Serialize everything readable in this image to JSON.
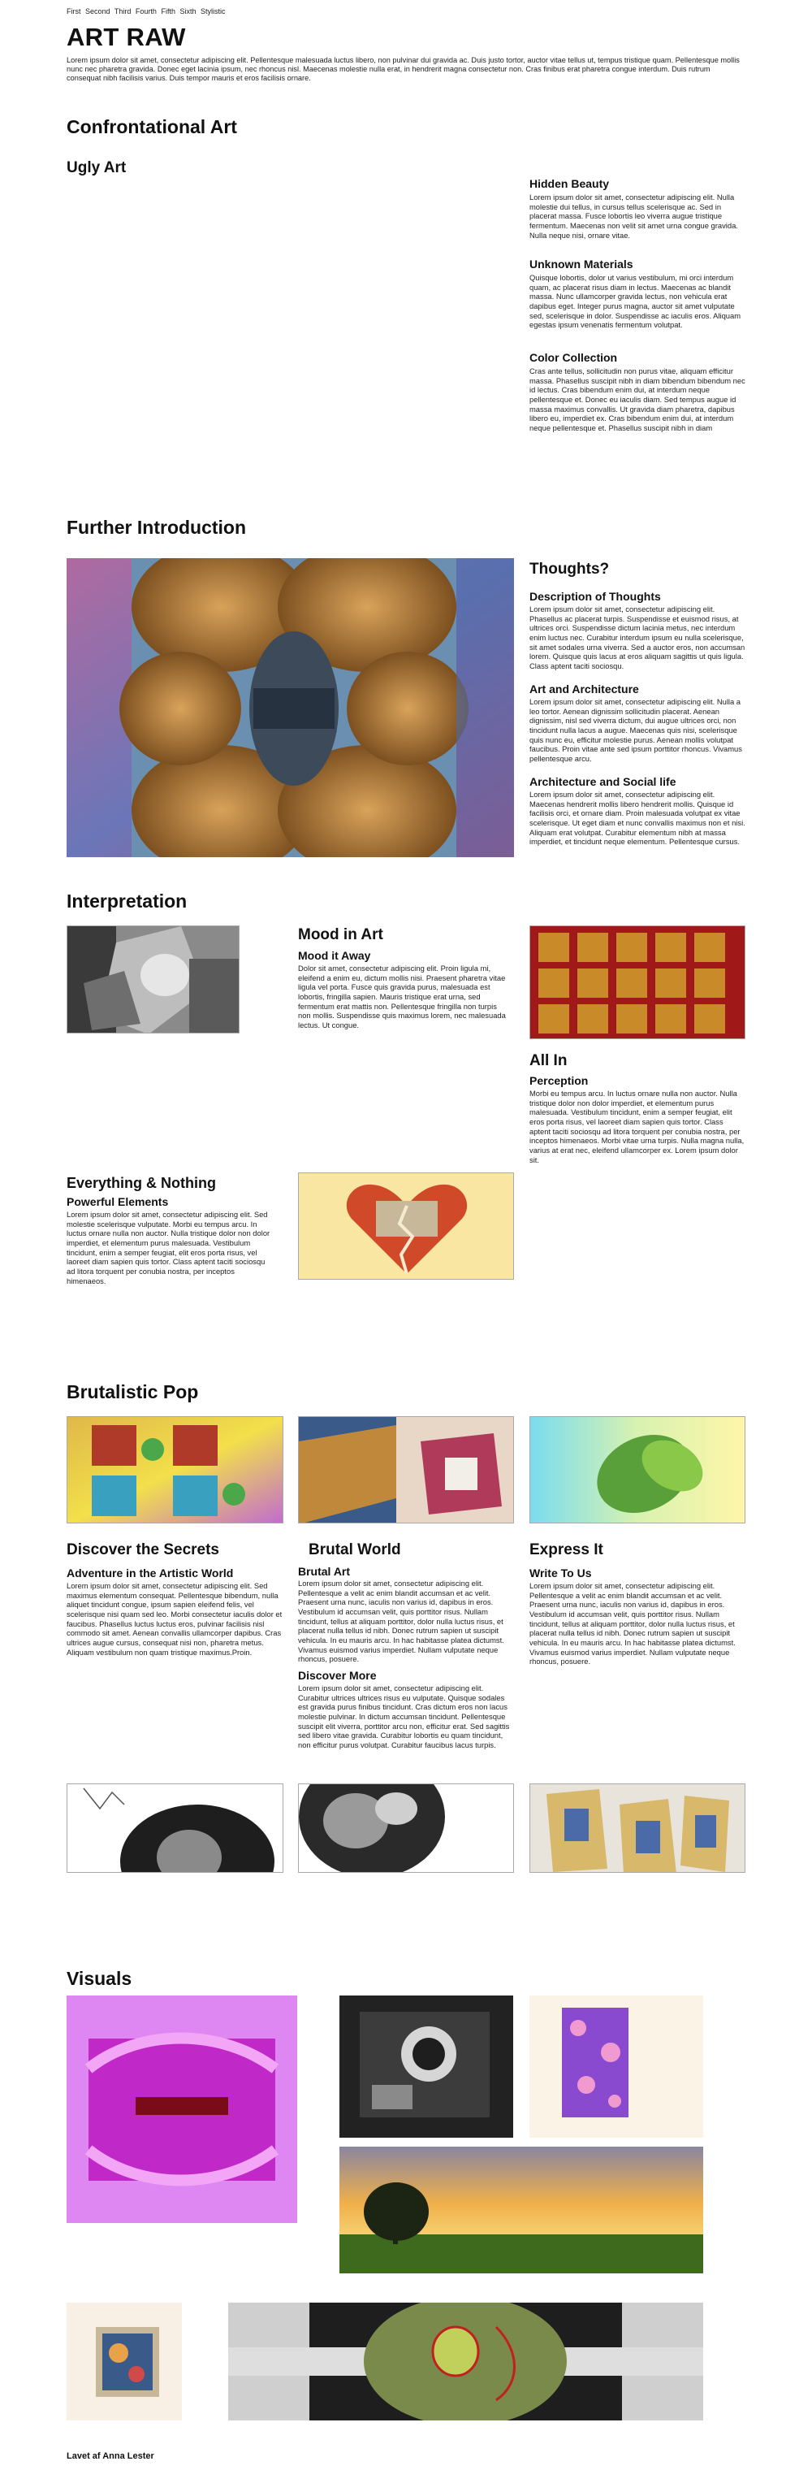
{
  "nav": [
    "First",
    "Second",
    "Third",
    "Fourth",
    "Fifth",
    "Sixth",
    "Stylistic"
  ],
  "site_title": "ART RAW",
  "intro": "Lorem ipsum dolor sit amet, consectetur adipiscing elit. Pellentesque malesuada luctus libero, non pulvinar dui gravida ac. Duis justo tortor, auctor vitae tellus ut, tempus tristique quam. Pellentesque mollis nunc nec pharetra gravida. Donec eget lacinia ipsum, nec rhoncus nisl. Maecenas molestie nulla erat, in hendrerit magna consectetur non. Cras finibus erat pharetra congue interdum. Duis rutrum consequat nibh facilisis varius. Duis tempor mauris et eros facilisis ornare.",
  "s1": {
    "title": "Confrontational Art",
    "subtitle": "Ugly Art",
    "cols": [
      {
        "h": "Hidden Beauty",
        "p": "Lorem ipsum dolor sit amet, consectetur adipiscing elit. Nulla molestie dui tellus, in cursus tellus scelerisque ac. Sed in placerat massa. Fusce lobortis leo viverra augue tristique fermentum. Maecenas non velit sit amet urna congue gravida. Nulla neque nisi, ornare vitae."
      },
      {
        "h": "Unknown Materials",
        "p": "Quisque lobortis, dolor ut varius vestibulum, mi orci interdum quam, ac placerat risus diam in lectus. Maecenas ac blandit massa. Nunc ullamcorper gravida lectus, non vehicula erat dapibus eget. Integer purus magna, auctor sit amet vulputate sed, scelerisque in dolor. Suspendisse ac iaculis eros. Aliquam egestas ipsum venenatis fermentum volutpat."
      },
      {
        "h": "Color Collection",
        "p": "Cras ante tellus, sollicitudin non purus vitae, aliquam efficitur massa. Phasellus suscipit nibh in diam bibendum bibendum nec id lectus. Cras bibendum enim dui, at interdum neque pellentesque et. Donec eu iaculis diam. Sed tempus augue id massa maximus convallis. Ut gravida diam pharetra, dapibus libero eu, imperdiet ex. Cras bibendum enim dui, at interdum neque pellentesque et. Phasellus suscipit nibh in diam"
      }
    ]
  },
  "s2": {
    "title": "Further Introduction",
    "aside_title": "Thoughts?",
    "cols": [
      {
        "h": "Description of Thoughts",
        "p": "Lorem ipsum dolor sit amet, consectetur adipiscing elit. Phasellus ac placerat turpis. Suspendisse et euismod risus, at ultrices orci. Suspendisse dictum lacinia metus, nec interdum enim luctus nec. Curabitur interdum ipsum eu nulla scelerisque, sit amet sodales urna viverra. Sed a auctor eros, non accumsan lorem. Quisque quis lacus at eros aliquam sagittis ut quis ligula. Class aptent taciti sociosqu."
      },
      {
        "h": "Art and Architecture",
        "p": "Lorem ipsum dolor sit amet, consectetur adipiscing elit. Nulla a leo tortor. Aenean dignissim sollicitudin placerat. Aenean dignissim, nisl sed viverra dictum, dui augue ultrices orci, non tincidunt nulla lacus a augue. Maecenas quis nisi, scelerisque quis nunc eu, efficitur molestie purus. Aenean mollis volutpat faucibus. Proin vitae ante sed ipsum porttitor rhoncus. Vivamus pellentesque arcu."
      },
      {
        "h": "Architecture and Social life",
        "p": "Lorem ipsum dolor sit amet, consectetur adipiscing elit. Maecenas hendrerit mollis libero hendrerit mollis. Quisque id facilisis orci, et ornare diam. Proin malesuada volutpat ex vitae scelerisque. Ut eget diam et nunc convallis maximus non et nisi. Aliquam erat volutpat. Curabitur elementum nibh at massa imperdiet, et tincidunt neque elementum. Pellentesque cursus."
      }
    ]
  },
  "s3": {
    "title": "Interpretation",
    "mood": {
      "h": "Mood in Art",
      "sub": "Mood it Away",
      "p": "Dolor sit amet, consectetur adipiscing elit. Proin ligula mi, eleifend a enim eu, dictum mollis nisi. Praesent pharetra vitae ligula vel porta. Fusce quis gravida purus, malesuada est lobortis, fringilla sapien. Mauris tristique erat urna, sed fermentum erat mattis non. Pellentesque fringilla non turpis non mollis. Suspendisse quis maximus lorem, nec malesuada lectus. Ut congue."
    },
    "allin": {
      "h": "All In",
      "sub": "Perception",
      "p": "Morbi eu tempus arcu. In luctus ornare nulla non auctor. Nulla tristique dolor non dolor imperdiet, et elementum purus malesuada. Vestibulum tincidunt, enim a semper feugiat, elit eros porta risus, vel laoreet diam sapien quis tortor. Class aptent taciti sociosqu ad litora torquent per conubia nostra, per inceptos himenaeos. Morbi vitae urna turpis. Nulla magna nulla, varius at erat nec, eleifend ullamcorper ex. Lorem ipsum dolor sit."
    },
    "everything": {
      "h": "Everything & Nothing",
      "sub": "Powerful Elements",
      "p": "Lorem ipsum dolor sit amet, consectetur adipiscing elit. Sed molestie scelerisque vulputate. Morbi eu tempus arcu. In luctus ornare nulla non auctor. Nulla tristique dolor non dolor imperdiet, et elementum purus malesuada. Vestibulum tincidunt, enim a semper feugiat, elit eros porta risus, vel laoreet diam sapien quis tortor. Class aptent taciti sociosqu ad litora torquent per conubia nostra, per inceptos himenaeos."
    }
  },
  "s4": {
    "title": "Brutalistic Pop",
    "cols": [
      {
        "h": "Discover the Secrets",
        "sub": "Adventure in the Artistic World",
        "p": "Lorem ipsum dolor sit amet, consectetur adipiscing elit. Sed maximus elementum consequat. Pellentesque bibendum, nulla aliquet tincidunt congue, ipsum sapien eleifend felis, vel scelerisque nisi quam sed leo. Morbi consectetur iaculis dolor et faucibus. Phasellus luctus luctus eros, pulvinar facilisis nisl commodo sit amet. Aenean convallis ullamcorper dapibus. Cras ultrices augue cursus, consequat nisi non, pharetra metus. Aliquam vestibulum non quam tristique maximus.Proin."
      },
      {
        "h": "Brutal World",
        "sub": "Brutal Art",
        "p": "Lorem ipsum dolor sit amet, consectetur adipiscing elit. Pellentesque a velit ac enim blandit accumsan et ac velit. Praesent urna nunc, iaculis non varius id, dapibus in eros. Vestibulum id accumsan velit, quis porttitor risus. Nullam tincidunt, tellus at aliquam porttitor, dolor nulla luctus risus, et placerat nulla tellus id nibh. Donec rutrum sapien ut suscipit vehicula. In eu mauris arcu. In hac habitasse platea dictumst. Vivamus euismod varius imperdiet. Nullam vulputate neque rhoncus, posuere.",
        "sub2": "Discover More",
        "p2": "Lorem ipsum dolor sit amet, consectetur adipiscing elit. Curabitur ultrices ultrices risus eu vulputate. Quisque sodales est gravida purus finibus tincidunt. Cras dictum eros non lacus molestie pulvinar. In dictum accumsan tincidunt. Pellentesque suscipit elit viverra, porttitor arcu non, efficitur erat. Sed sagittis sed libero vitae gravida. Curabitur lobortis eu quam tincidunt, non efficitur purus volutpat. Curabitur faucibus lacus turpis."
      },
      {
        "h": "Express It",
        "sub": "Write To Us",
        "p": "Lorem ipsum dolor sit amet, consectetur adipiscing elit. Pellentesque a velit ac enim blandit accumsan et ac velit. Praesent urna nunc, iaculis non varius id, dapibus in eros. Vestibulum id accumsan velit, quis porttitor risus. Nullam tincidunt, tellus at aliquam porttitor, dolor nulla luctus risus, et placerat nulla tellus id nibh. Donec rutrum sapien ut suscipit vehicula. In eu mauris arcu. In hac habitasse platea dictumst. Vivamus euismod varius imperdiet. Nullam vulputate neque rhoncus, posuere."
      }
    ]
  },
  "s5": {
    "title": "Visuals"
  },
  "credit": "Lavet af Anna Lester"
}
